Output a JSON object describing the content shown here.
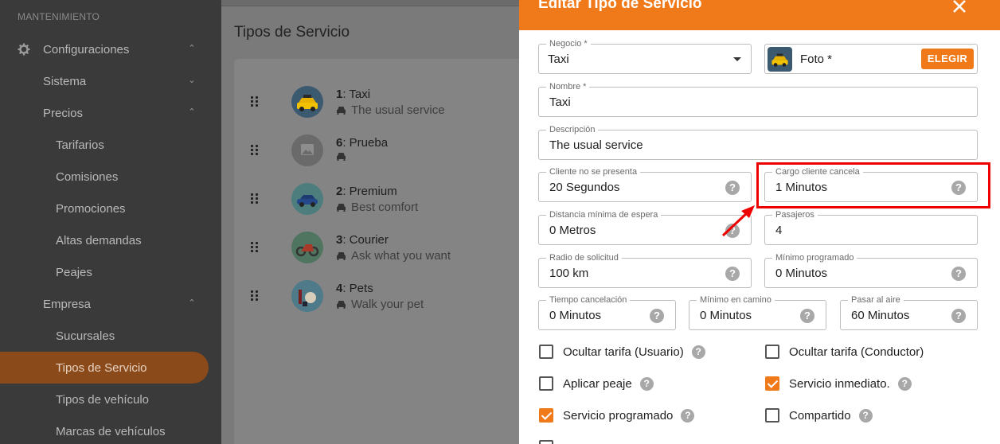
{
  "sidebar": {
    "section": "MANTENIMIENTO",
    "items": [
      {
        "label": "Configuraciones"
      },
      {
        "label": "Sistema"
      },
      {
        "label": "Precios"
      },
      {
        "label": "Tarifarios"
      },
      {
        "label": "Comisiones"
      },
      {
        "label": "Promociones"
      },
      {
        "label": "Altas demandas"
      },
      {
        "label": "Peajes"
      },
      {
        "label": "Empresa"
      },
      {
        "label": "Sucursales"
      },
      {
        "label": "Tipos de Servicio"
      },
      {
        "label": "Tipos de vehículo"
      },
      {
        "label": "Marcas de vehículos"
      }
    ]
  },
  "main": {
    "title": "Tipos de Servicio",
    "services": [
      {
        "id": "1",
        "name": ": Taxi",
        "desc": "The usual service"
      },
      {
        "id": "6",
        "name": ": Prueba",
        "desc": ""
      },
      {
        "id": "2",
        "name": ": Premium",
        "desc": "Best comfort"
      },
      {
        "id": "3",
        "name": ": Courier",
        "desc": "Ask what you want"
      },
      {
        "id": "4",
        "name": ": Pets",
        "desc": "Walk your pet"
      }
    ]
  },
  "modal": {
    "title": "Editar Tipo de Servicio",
    "negocio": {
      "label": "Negocio *",
      "value": "Taxi"
    },
    "foto": {
      "label": "Foto *",
      "button": "ELEGIR"
    },
    "nombre": {
      "label": "Nombre *",
      "value": "Taxi"
    },
    "descripcion": {
      "label": "Descripción",
      "value": "The usual service"
    },
    "no_presenta": {
      "label": "Cliente no se presenta",
      "value": "20 Segundos"
    },
    "cargo_cancela": {
      "label": "Cargo cliente cancela",
      "value": "1 Minutos"
    },
    "distancia": {
      "label": "Distancia mínima de espera",
      "value": "0 Metros"
    },
    "pasajeros": {
      "label": "Pasajeros",
      "value": "4"
    },
    "radio": {
      "label": "Radio de solicitud",
      "value": "100 km"
    },
    "min_programado": {
      "label": "Mínimo programado",
      "value": "0 Minutos"
    },
    "tiempo_cancel": {
      "label": "Tiempo cancelación",
      "value": "0 Minutos"
    },
    "min_camino": {
      "label": "Mínimo en camino",
      "value": "0 Minutos"
    },
    "pasar_aire": {
      "label": "Pasar al aire",
      "value": "60 Minutos"
    },
    "help_glyph": "?",
    "checks": [
      {
        "label": "Ocultar tarifa (Usuario)",
        "checked": false
      },
      {
        "label": "Ocultar tarifa (Conductor)",
        "checked": false
      },
      {
        "label": "Aplicar peaje",
        "checked": false
      },
      {
        "label": "Servicio inmediato.",
        "checked": true
      },
      {
        "label": "Servicio programado",
        "checked": true
      },
      {
        "label": "Compartido",
        "checked": false
      }
    ]
  },
  "colors": {
    "accent": "#f07a1a",
    "highlight": "#ee0000"
  }
}
